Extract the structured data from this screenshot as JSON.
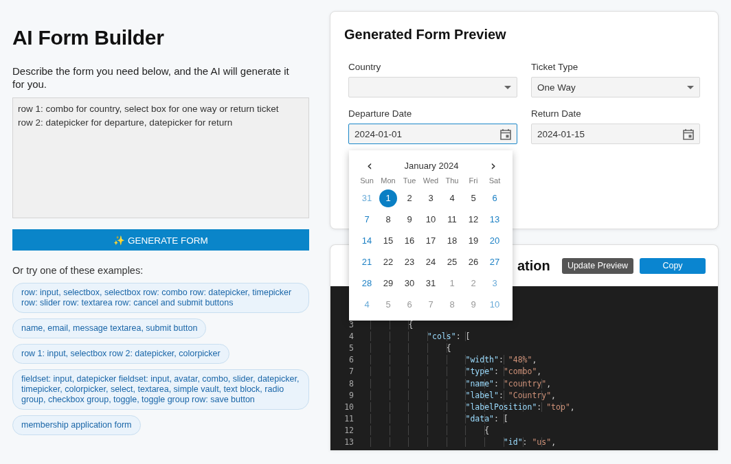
{
  "builder": {
    "title": "AI Form Builder",
    "description": "Describe the form you need below, and the AI will generate it for you.",
    "prompt": "row 1: combo for country, select box for one way or return ticket\nrow 2: datepicker for departure, datepicker for return",
    "generate_button": "✨ GENERATE FORM",
    "examples_heading": "Or try one of these examples:",
    "examples": [
      "row: input, selectbox, selectbox row: combo row: datepicker, timepicker row: slider row: textarea row: cancel and submit buttons",
      "name, email, message textarea, submit button",
      "row 1: input, selectbox row 2: datepicker, colorpicker",
      "fieldset: input, datepicker fieldset: input, avatar, combo, slider, datepicker, timepicker, colorpicker, select, textarea, simple vault, text block, radio group, checkbox group, toggle, toggle group row: save button",
      "membership application form"
    ]
  },
  "preview": {
    "title": "Generated Form Preview",
    "fields": [
      {
        "label": "Country",
        "kind": "select",
        "focused": false
      },
      {
        "label": "Ticket Type",
        "kind": "select",
        "value": "One Way",
        "focused": false
      },
      {
        "label": "Departure Date",
        "kind": "date",
        "value": "2024-01-01",
        "focused": true
      },
      {
        "label": "Return Date",
        "kind": "date",
        "value": "2024-01-15",
        "focused": false
      }
    ]
  },
  "calendar": {
    "month": "January 2024",
    "prev": "‹",
    "next": "›",
    "weekdays": [
      "Sun",
      "Mon",
      "Tue",
      "Wed",
      "Thu",
      "Fri",
      "Sat"
    ],
    "weeks": [
      [
        {
          "label": "31",
          "outside": true,
          "selected": false
        },
        {
          "label": "1",
          "outside": false,
          "selected": true
        },
        {
          "label": "2",
          "outside": false,
          "selected": false
        },
        {
          "label": "3",
          "outside": false,
          "selected": false
        },
        {
          "label": "4",
          "outside": false,
          "selected": false
        },
        {
          "label": "5",
          "outside": false,
          "selected": false
        },
        {
          "label": "6",
          "outside": false,
          "selected": false
        }
      ],
      [
        {
          "label": "7",
          "outside": false,
          "selected": false
        },
        {
          "label": "8",
          "outside": false,
          "selected": false
        },
        {
          "label": "9",
          "outside": false,
          "selected": false
        },
        {
          "label": "10",
          "outside": false,
          "selected": false
        },
        {
          "label": "11",
          "outside": false,
          "selected": false
        },
        {
          "label": "12",
          "outside": false,
          "selected": false
        },
        {
          "label": "13",
          "outside": false,
          "selected": false
        }
      ],
      [
        {
          "label": "14",
          "outside": false,
          "selected": false
        },
        {
          "label": "15",
          "outside": false,
          "selected": false
        },
        {
          "label": "16",
          "outside": false,
          "selected": false
        },
        {
          "label": "17",
          "outside": false,
          "selected": false
        },
        {
          "label": "18",
          "outside": false,
          "selected": false
        },
        {
          "label": "19",
          "outside": false,
          "selected": false
        },
        {
          "label": "20",
          "outside": false,
          "selected": false
        }
      ],
      [
        {
          "label": "21",
          "outside": false,
          "selected": false
        },
        {
          "label": "22",
          "outside": false,
          "selected": false
        },
        {
          "label": "23",
          "outside": false,
          "selected": false
        },
        {
          "label": "24",
          "outside": false,
          "selected": false
        },
        {
          "label": "25",
          "outside": false,
          "selected": false
        },
        {
          "label": "26",
          "outside": false,
          "selected": false
        },
        {
          "label": "27",
          "outside": false,
          "selected": false
        }
      ],
      [
        {
          "label": "28",
          "outside": false,
          "selected": false
        },
        {
          "label": "29",
          "outside": false,
          "selected": false
        },
        {
          "label": "30",
          "outside": false,
          "selected": false
        },
        {
          "label": "31",
          "outside": false,
          "selected": false
        },
        {
          "label": "1",
          "outside": true,
          "selected": false
        },
        {
          "label": "2",
          "outside": true,
          "selected": false
        },
        {
          "label": "3",
          "outside": true,
          "selected": false
        }
      ],
      [
        {
          "label": "4",
          "outside": true,
          "selected": false
        },
        {
          "label": "5",
          "outside": true,
          "selected": false
        },
        {
          "label": "6",
          "outside": true,
          "selected": false
        },
        {
          "label": "7",
          "outside": true,
          "selected": false
        },
        {
          "label": "8",
          "outside": true,
          "selected": false
        },
        {
          "label": "9",
          "outside": true,
          "selected": false
        },
        {
          "label": "10",
          "outside": true,
          "selected": false
        }
      ]
    ]
  },
  "config": {
    "title_end": "ation",
    "buttons": [
      {
        "label": "Update Preview",
        "kind": "secondary"
      },
      {
        "label": "Copy",
        "kind": "primary"
      }
    ],
    "lines": [
      {
        "number": "3",
        "tokens": [
          {
            "kind": "punct",
            "text": "        {"
          }
        ]
      },
      {
        "number": "4",
        "tokens": [
          {
            "kind": "key",
            "text": "            \"cols\""
          },
          {
            "kind": "punct",
            "text": ": ["
          }
        ]
      },
      {
        "number": "5",
        "tokens": [
          {
            "kind": "punct",
            "text": "                {"
          }
        ]
      },
      {
        "number": "6",
        "tokens": [
          {
            "kind": "key",
            "text": "                    \"width\""
          },
          {
            "kind": "punct",
            "text": ": "
          },
          {
            "kind": "string",
            "text": "\"48%\""
          },
          {
            "kind": "punct",
            "text": ","
          }
        ]
      },
      {
        "number": "7",
        "tokens": [
          {
            "kind": "key",
            "text": "                    \"type\""
          },
          {
            "kind": "punct",
            "text": ": "
          },
          {
            "kind": "string",
            "text": "\"combo\""
          },
          {
            "kind": "punct",
            "text": ","
          }
        ]
      },
      {
        "number": "8",
        "tokens": [
          {
            "kind": "key",
            "text": "                    \"name\""
          },
          {
            "kind": "punct",
            "text": ": "
          },
          {
            "kind": "string",
            "text": "\"country\""
          },
          {
            "kind": "punct",
            "text": ","
          }
        ]
      },
      {
        "number": "9",
        "tokens": [
          {
            "kind": "key",
            "text": "                    \"label\""
          },
          {
            "kind": "punct",
            "text": ": "
          },
          {
            "kind": "string",
            "text": "\"Country\""
          },
          {
            "kind": "punct",
            "text": ","
          }
        ]
      },
      {
        "number": "10",
        "tokens": [
          {
            "kind": "key",
            "text": "                    \"labelPosition\""
          },
          {
            "kind": "punct",
            "text": ": "
          },
          {
            "kind": "string",
            "text": "\"top\""
          },
          {
            "kind": "punct",
            "text": ","
          }
        ]
      },
      {
        "number": "11",
        "tokens": [
          {
            "kind": "key",
            "text": "                    \"data\""
          },
          {
            "kind": "punct",
            "text": ": ["
          }
        ]
      },
      {
        "number": "12",
        "tokens": [
          {
            "kind": "punct",
            "text": "                        {"
          }
        ]
      },
      {
        "number": "13",
        "tokens": [
          {
            "kind": "key",
            "text": "                            \"id\""
          },
          {
            "kind": "punct",
            "text": ": "
          },
          {
            "kind": "string",
            "text": "\"us\""
          },
          {
            "kind": "punct",
            "text": ","
          }
        ]
      }
    ]
  }
}
